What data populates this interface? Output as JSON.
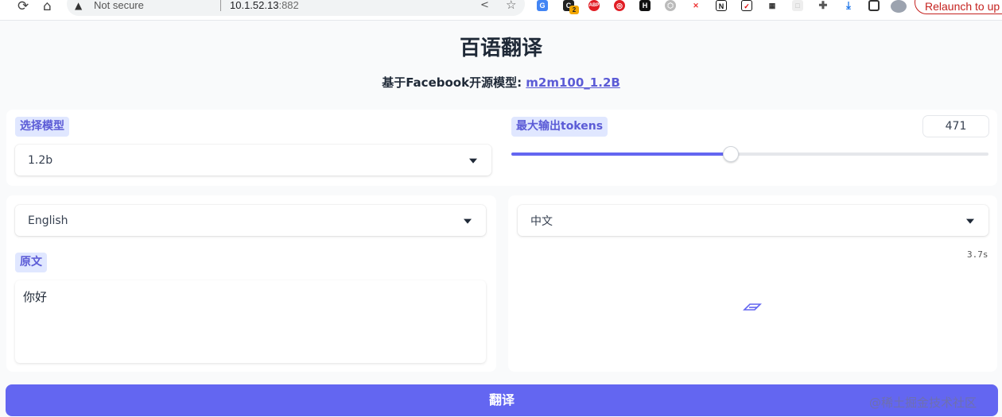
{
  "browser": {
    "security_label": "Not secure",
    "url_host": "10.1.52.13",
    "url_port": ":882",
    "relaunch_label": "Relaunch to up",
    "extension_badge": "2"
  },
  "app": {
    "title": "百语翻译",
    "subtitle_prefix": "基于Facebook开源模型: ",
    "model_link": "m2m100_1.2B"
  },
  "controls": {
    "model_label": "选择模型",
    "model_value": "1.2b",
    "max_tokens_label": "最大输出tokens",
    "max_tokens_value": "471",
    "max_tokens_fraction": 0.46
  },
  "source": {
    "language": "English",
    "text_label": "原文",
    "text_value": "你好"
  },
  "target": {
    "language": "中文",
    "elapsed": "3.7s"
  },
  "actions": {
    "translate_label": "翻译"
  },
  "watermark": "@稀土掘金技术社区",
  "colors": {
    "accent": "#6366f1",
    "label_bg": "#e0e7ff",
    "label_text": "#5b5bd6"
  }
}
